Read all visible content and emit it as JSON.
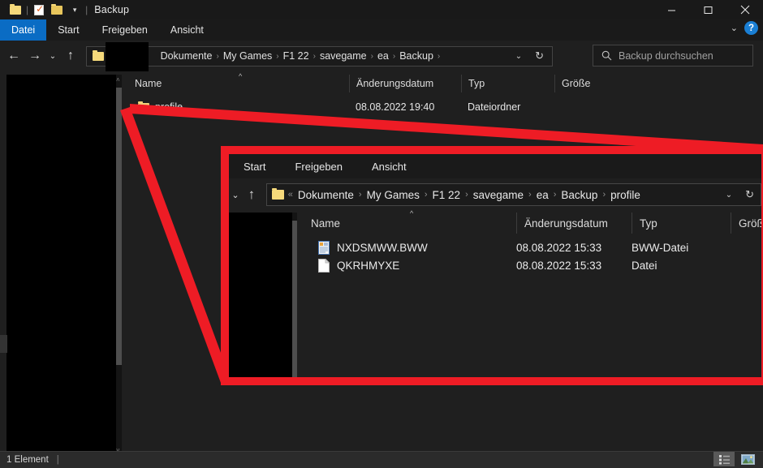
{
  "colors": {
    "accent": "#0a6cc4",
    "annotation_red": "#ee1c25",
    "folder_yellow": "#f2d279",
    "help_blue": "#1a7fd4"
  },
  "main_window": {
    "title": "Backup",
    "quick_access": [
      {
        "icon": "folder-icon",
        "name": "quick-access-folder"
      },
      {
        "icon": "properties-icon",
        "name": "quick-access-properties"
      },
      {
        "icon": "folder-icon",
        "name": "quick-access-new-folder"
      },
      {
        "icon": "chevron-down-icon",
        "name": "quick-access-customize"
      }
    ],
    "window_controls": {
      "minimize": "—",
      "maximize": "▢",
      "close": "✕"
    },
    "ribbon": {
      "collapse_icon": "chevron-down-icon",
      "help_label": "?"
    },
    "tabs": [
      {
        "label": "Datei",
        "active": true
      },
      {
        "label": "Start",
        "active": false
      },
      {
        "label": "Freigeben",
        "active": false
      },
      {
        "label": "Ansicht",
        "active": false
      }
    ],
    "nav": {
      "back": "←",
      "forward": "→",
      "recent": "⌄",
      "up": "↑",
      "breadcrumb_prefix": "«",
      "breadcrumb": [
        "Dokumente",
        "My Games",
        "F1 22",
        "savegame",
        "Backup"
      ],
      "breadcrumb_trailing_sep": "›",
      "dropdown": "⌄",
      "refresh": "↻",
      "redacted": true
    },
    "search": {
      "placeholder": "Backup durchsuchen",
      "icon": "search-icon",
      "value": ""
    },
    "columns": [
      {
        "label": "Name",
        "sorted": "asc",
        "sort_glyph": "^"
      },
      {
        "label": "Änderungsdatum"
      },
      {
        "label": "Typ"
      },
      {
        "label": "Größe"
      }
    ],
    "rows": [
      {
        "icon": "folder-icon",
        "name": "profile",
        "modified": "08.08.2022 19:40",
        "type": "Dateiordner",
        "size": ""
      }
    ],
    "status": {
      "count_label": "1 Element",
      "separator": "|"
    },
    "view_buttons": [
      {
        "name": "details-view-button",
        "icon": "details-view-icon",
        "active": true
      },
      {
        "name": "large-icons-view-button",
        "icon": "large-icons-view-icon",
        "active": false
      }
    ]
  },
  "inner_window": {
    "tabs": [
      {
        "label": "Start"
      },
      {
        "label": "Freigeben"
      },
      {
        "label": "Ansicht"
      }
    ],
    "nav": {
      "recent": "⌄",
      "up": "↑",
      "breadcrumb_prefix": "«",
      "breadcrumb": [
        "Dokumente",
        "My Games",
        "F1 22",
        "savegame",
        "ea",
        "Backup",
        "profile"
      ],
      "dropdown": "⌄",
      "refresh": "↻"
    },
    "columns": [
      {
        "label": "Name",
        "sorted": "asc",
        "sort_glyph": "^"
      },
      {
        "label": "Änderungsdatum"
      },
      {
        "label": "Typ"
      },
      {
        "label": "Größ"
      }
    ],
    "rows": [
      {
        "icon": "bww-file-icon",
        "name": "NXDSMWW.BWW",
        "modified": "08.08.2022 15:33",
        "type": "BWW-Datei"
      },
      {
        "icon": "generic-file-icon",
        "name": "QKRHMYXE",
        "modified": "08.08.2022 15:33",
        "type": "Datei"
      }
    ]
  },
  "annotation": {
    "shape": "red-zoom-cone",
    "color": "#ee1c25",
    "target": "profile"
  }
}
